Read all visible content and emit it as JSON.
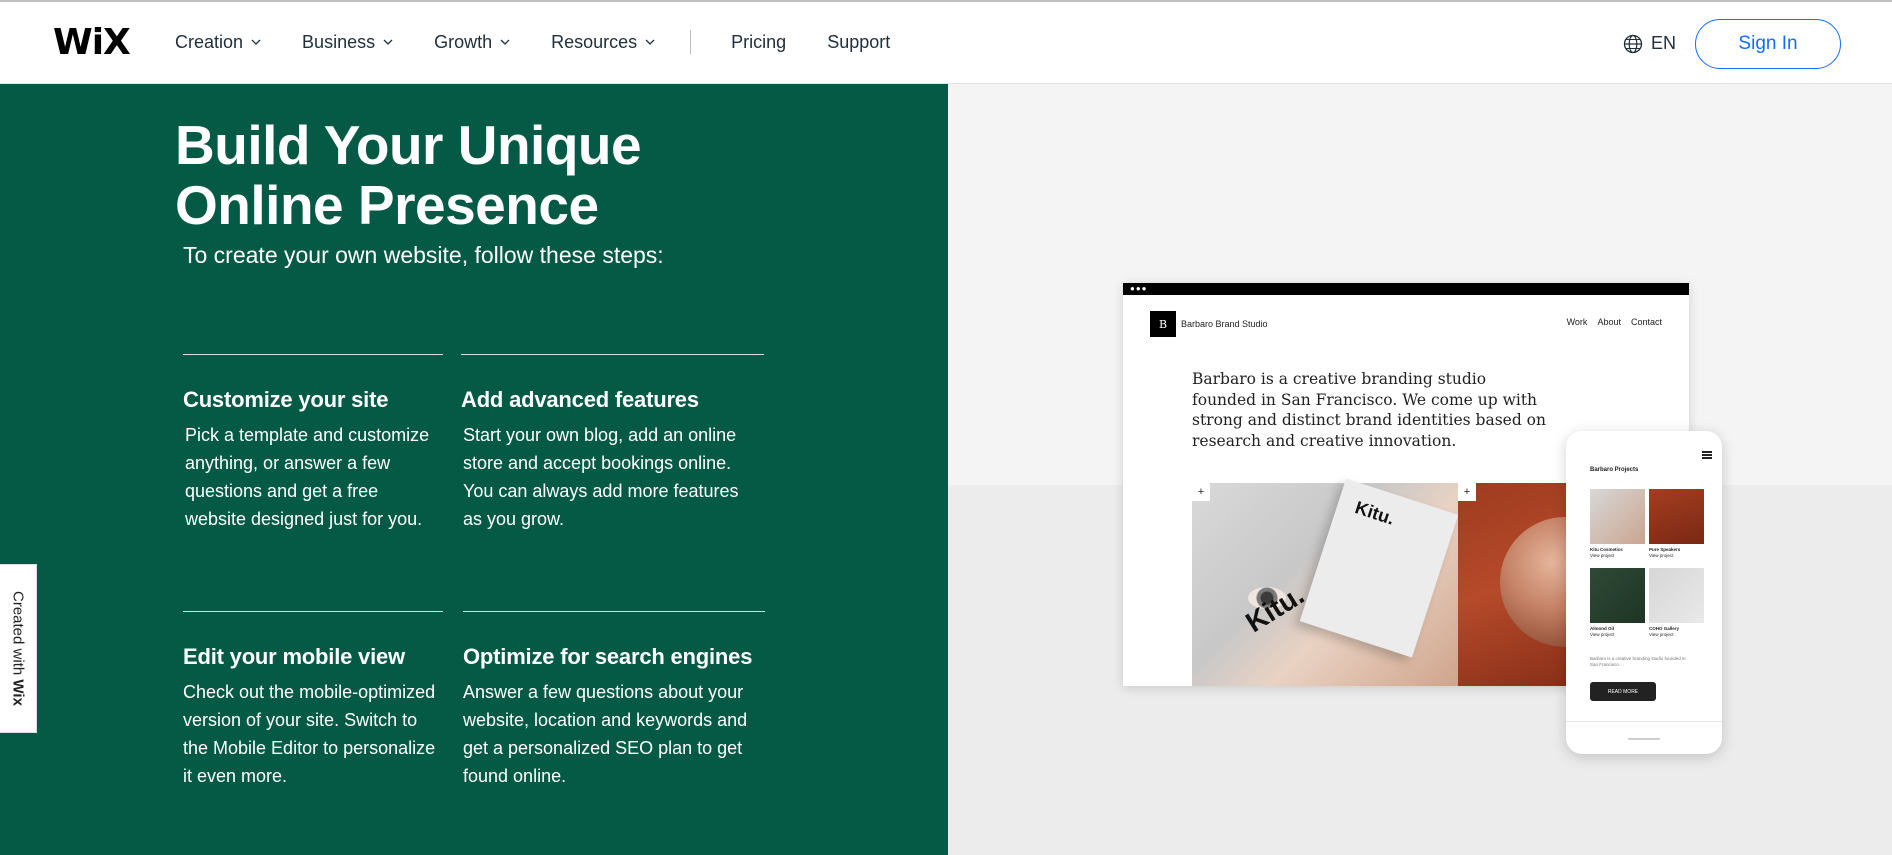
{
  "header": {
    "logo": "WiX",
    "nav": [
      {
        "label": "Creation",
        "dropdown": true
      },
      {
        "label": "Business",
        "dropdown": true
      },
      {
        "label": "Growth",
        "dropdown": true
      },
      {
        "label": "Resources",
        "dropdown": true
      }
    ],
    "nav_plain": [
      "Pricing",
      "Support"
    ],
    "language": "EN",
    "sign_in": "Sign In"
  },
  "hero": {
    "title": "Build Your Unique Online Presence",
    "subtitle": "To create your own website, follow these steps:"
  },
  "steps": [
    {
      "title": "Customize your site",
      "text": "Pick a template and customize anything, or answer a few questions and get a free website designed just for you."
    },
    {
      "title": "Add advanced features",
      "text": "Start your own blog, add an online store and accept bookings online. You can always add more features as you grow."
    },
    {
      "title": "Edit your mobile view",
      "text": "Check out the mobile-optimized version of your site. Switch to the Mobile Editor to personalize it even more."
    },
    {
      "title": "Optimize for search engines",
      "text": "Answer a few questions about your website, location and keywords and get a personalized SEO plan to get found online."
    }
  ],
  "mockup": {
    "desktop": {
      "logo_letter": "B",
      "brand": "Barbaro Brand Studio",
      "menu": [
        "Work",
        "About",
        "Contact"
      ],
      "intro": "Barbaro is a creative branding studio founded in San Francisco. We come up with strong and distinct brand identities based on research and creative innovation.",
      "box_label": "Kitu.",
      "face_label": "Kitu."
    },
    "phone": {
      "title": "Barbaro Projects",
      "projects": [
        {
          "name": "Kitu Cosmetics",
          "link": "View project"
        },
        {
          "name": "Pure Speakers",
          "link": "View project"
        },
        {
          "name": "Almond Oil",
          "link": "View project"
        },
        {
          "name": "COHO Gallery",
          "link": "View project"
        }
      ],
      "description": "Barbaro is a creative branding studio founded in San Francisco.",
      "button": "READ MORE"
    }
  },
  "badge": {
    "prefix": "Created with ",
    "brand": "Wix"
  },
  "colors": {
    "green": "#045a45",
    "accent": "#116dff"
  }
}
